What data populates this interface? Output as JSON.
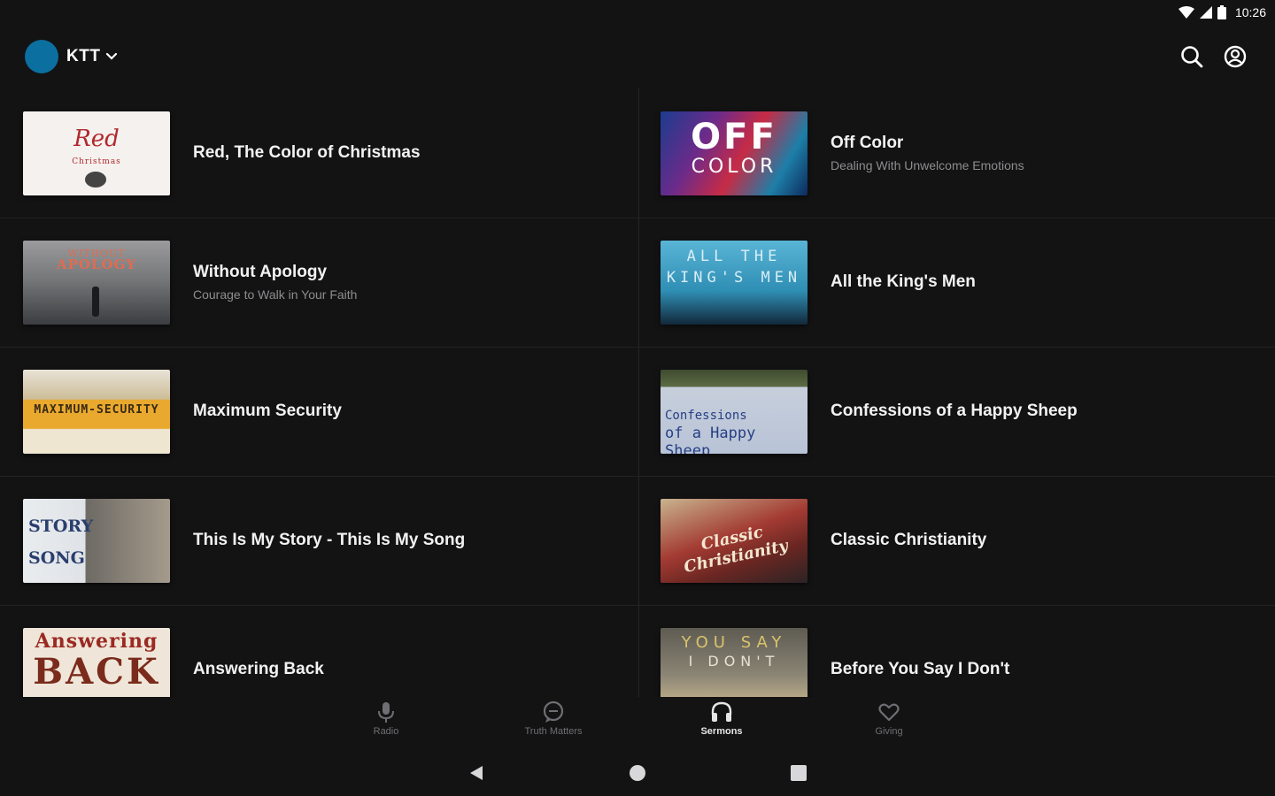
{
  "status_bar": {
    "time": "10:26"
  },
  "header": {
    "station_name": "KTT"
  },
  "series": [
    {
      "title": "Red, The Color of Christmas",
      "subtitle": "",
      "thumb": {
        "line1": "Red",
        "line2": "Christmas"
      }
    },
    {
      "title": "Off Color",
      "subtitle": "Dealing With Unwelcome Emotions",
      "thumb": {
        "line1": "OFF",
        "line2": "COLOR"
      }
    },
    {
      "title": "Without Apology",
      "subtitle": "Courage to Walk in Your Faith",
      "thumb": {
        "line1": "WITHOUT",
        "line2": "APOLOGY"
      }
    },
    {
      "title": "All the King's Men",
      "subtitle": "",
      "thumb": {
        "line1": "ALL THE",
        "line2": "KING'S MEN"
      }
    },
    {
      "title": "Maximum Security",
      "subtitle": "",
      "thumb": {
        "line1": "MAXIMUM-SECURITY",
        "line2": ""
      }
    },
    {
      "title": "Confessions of a Happy Sheep",
      "subtitle": "",
      "thumb": {
        "line1": "Confessions",
        "line2": "of a Happy Sheep"
      }
    },
    {
      "title": "This Is My Story - This Is My Song",
      "subtitle": "",
      "thumb": {
        "line1": "STORY",
        "line2": "SONG"
      }
    },
    {
      "title": "Classic Christianity",
      "subtitle": "",
      "thumb": {
        "line1": "Classic Christianity",
        "line2": ""
      }
    },
    {
      "title": "Answering Back",
      "subtitle": "",
      "thumb": {
        "line1": "Answering",
        "line2": "BACK"
      }
    },
    {
      "title": "Before You Say I Don't",
      "subtitle": "",
      "thumb": {
        "line1": "YOU SAY",
        "line2": "I DON'T"
      }
    }
  ],
  "bottom_nav": [
    {
      "label": "Radio",
      "icon": "microphone-icon",
      "active": false
    },
    {
      "label": "Truth Matters",
      "icon": "chat-bubble-icon",
      "active": false
    },
    {
      "label": "Sermons",
      "icon": "headphones-icon",
      "active": true
    },
    {
      "label": "Giving",
      "icon": "heart-icon",
      "active": false
    }
  ],
  "colors": {
    "background": "#131314",
    "station_logo": "#0b6fa0",
    "active_nav": "#e6e6e8",
    "inactive_nav": "#6f6f73"
  }
}
